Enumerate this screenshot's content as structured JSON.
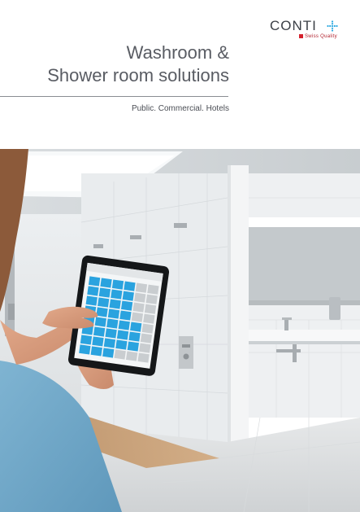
{
  "brand": {
    "name": "CONTI",
    "tagline": "Swiss Quality",
    "cross_color": "#2aa8e0",
    "flag_color": "#d4202c"
  },
  "cover": {
    "title_line1": "Washroom &",
    "title_line2": "Shower room solutions",
    "subtitle": "Public. Commercial. Hotels"
  },
  "photo": {
    "description_icon": "tablet-washroom-photo",
    "accent_tile_color": "#2aa3df"
  }
}
